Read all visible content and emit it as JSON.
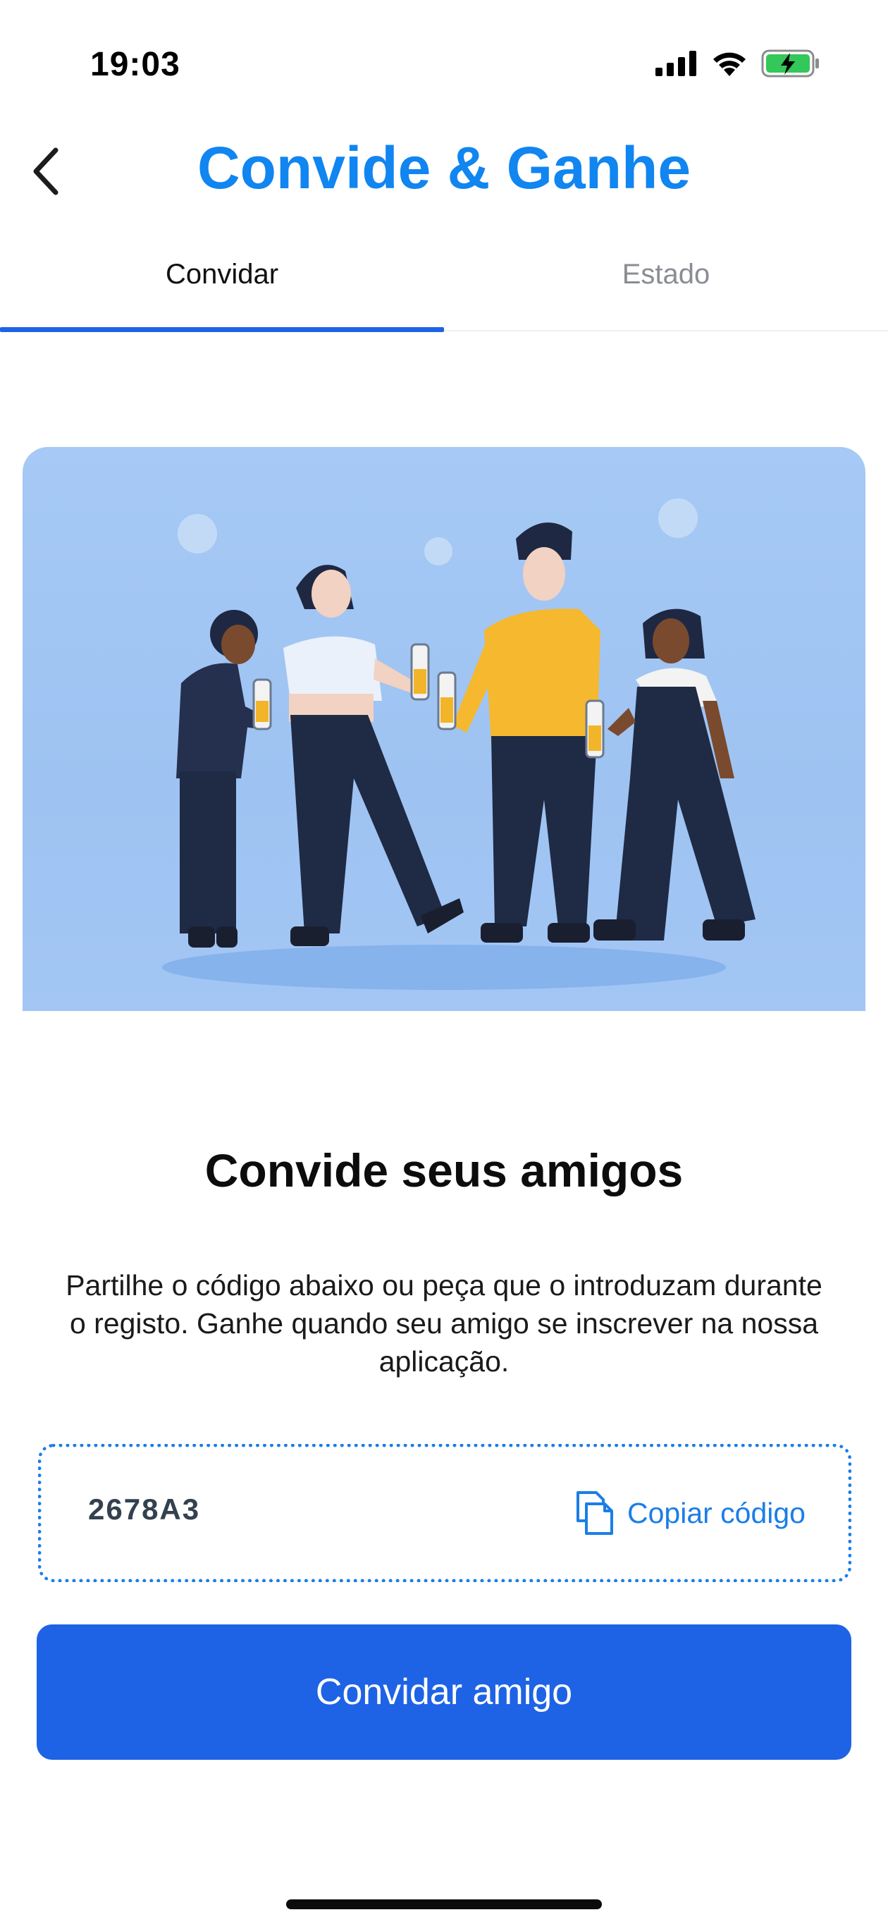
{
  "status_bar": {
    "time": "19:03",
    "battery_color": "#34c759"
  },
  "nav": {
    "back_icon": "chevron-left-icon",
    "title": "Convide & Ganhe",
    "title_color": "#1185f0"
  },
  "tabs": [
    {
      "label": "Convidar",
      "active": true
    },
    {
      "label": "Estado",
      "active": false
    }
  ],
  "invite": {
    "heading": "Convide seus amigos",
    "description": "Partilhe o código abaixo ou peça que o introduzam durante o registo. Ganhe quando seu amigo se inscrever na nossa aplicação.",
    "code": "2678A3",
    "copy_label": "Copiar código",
    "copy_icon": "copy-icon",
    "button_label": "Convidar amigo",
    "accent_color": "#1e63e6"
  }
}
